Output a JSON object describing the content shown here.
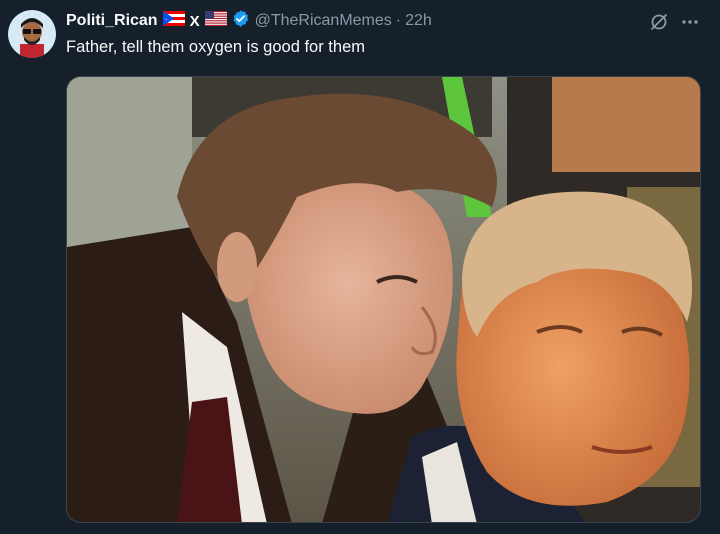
{
  "post": {
    "display_name": "Politi_Rican",
    "x_badge": "X",
    "handle": "@TheRicanMemes",
    "separator": "·",
    "timestamp": "22h",
    "text": "Father, tell them oxygen is good for them"
  },
  "icons": {
    "flag_1": "puerto-rico-flag",
    "flag_2": "us-flag",
    "verified": "verified-badge-icon",
    "grok": "grok-icon",
    "more": "more-icon"
  },
  "colors": {
    "background": "#15202b",
    "verified": "#1d9bf0",
    "secondary_text": "#8b98a5"
  }
}
